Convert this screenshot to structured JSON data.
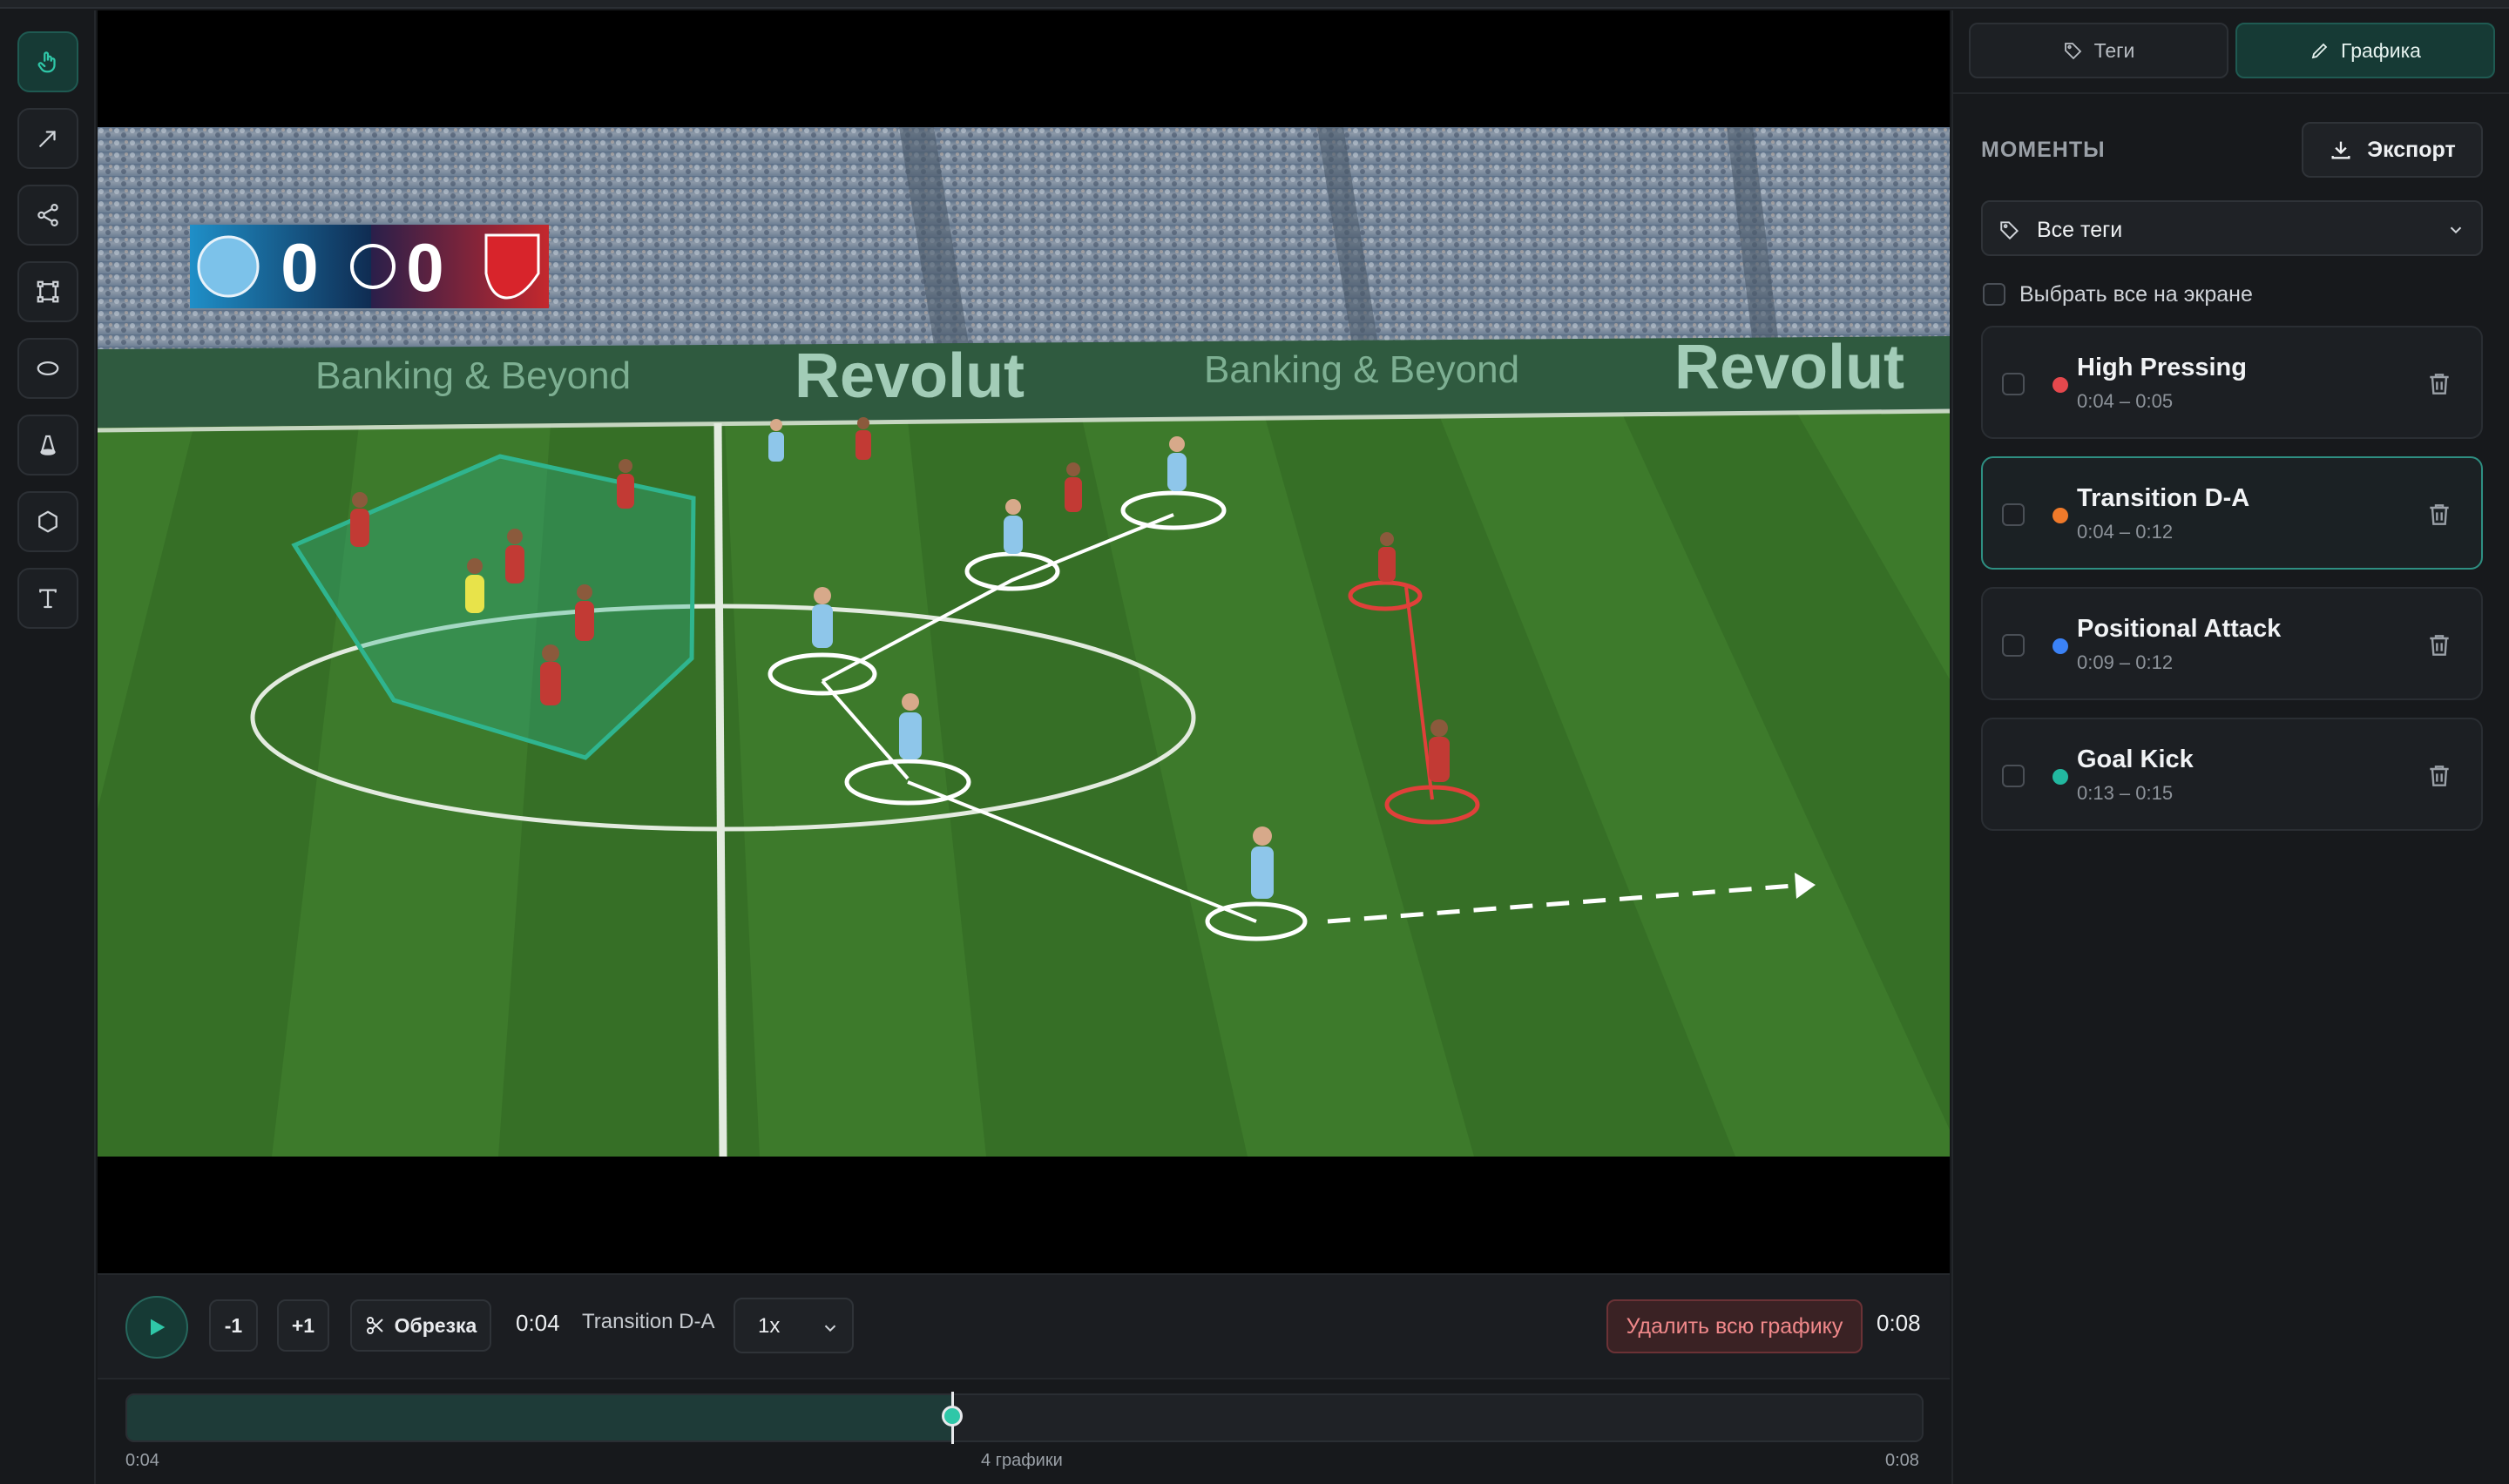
{
  "toolbar": {
    "tools": [
      {
        "name": "hand-tool",
        "icon": "hand-pointer-icon",
        "active": true
      },
      {
        "name": "arrow-tool",
        "icon": "arrow-icon"
      },
      {
        "name": "connect-tool",
        "icon": "share-nodes-icon"
      },
      {
        "name": "rect-tool",
        "icon": "bounding-box-icon"
      },
      {
        "name": "ellipse-tool",
        "icon": "ellipse-icon"
      },
      {
        "name": "spotlight-tool",
        "icon": "spotlight-cone-icon"
      },
      {
        "name": "polygon-tool",
        "icon": "hexagon-icon"
      },
      {
        "name": "text-tool",
        "icon": "text-icon"
      }
    ]
  },
  "video": {
    "score_home": "0",
    "score_away": "0",
    "sponsor_main": "Revolut",
    "sponsor_tag": "Banking & Beyond",
    "colors": {
      "pitch": "#3d7a2b",
      "home": "#8ec6ea",
      "away": "#c23a34",
      "zone": "#2fb58f"
    }
  },
  "controls": {
    "minus_label": "-1",
    "plus_label": "+1",
    "trim_label": "Обрезка",
    "current_time": "0:04",
    "moment_name": "Transition D-A",
    "speed": "1x",
    "delete_all_label": "Удалить всю графику",
    "end_time": "0:08"
  },
  "timeline": {
    "start": "0:04",
    "end": "0:08",
    "count_label": "4 графики",
    "progress": 0.46
  },
  "panel": {
    "tabs": {
      "tags": "Теги",
      "graphics": "Графика"
    },
    "moments_title": "МОМЕНТЫ",
    "export_label": "Экспорт",
    "filter_value": "Все теги",
    "select_all_label": "Выбрать все на экране",
    "moments": [
      {
        "name": "High Pressing",
        "time": "0:04 – 0:05",
        "color": "#e5484d"
      },
      {
        "name": "Transition D-A",
        "time": "0:04 – 0:12",
        "color": "#f07a2a",
        "selected": true
      },
      {
        "name": "Positional Attack",
        "time": "0:09 – 0:12",
        "color": "#3b82f6"
      },
      {
        "name": "Goal Kick",
        "time": "0:13 – 0:15",
        "color": "#22b8a0"
      }
    ]
  },
  "accent": "#2fc7a8"
}
